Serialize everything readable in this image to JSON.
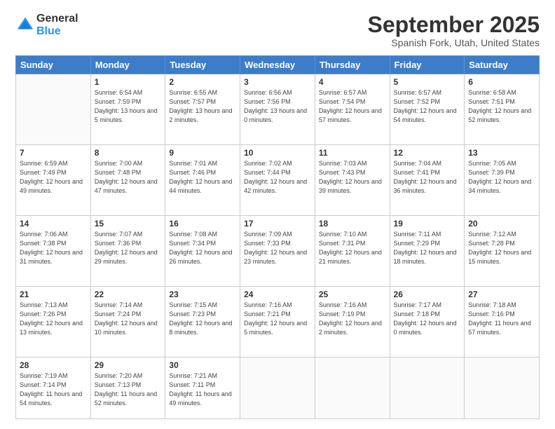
{
  "logo": {
    "general": "General",
    "blue": "Blue"
  },
  "header": {
    "month": "September 2025",
    "location": "Spanish Fork, Utah, United States"
  },
  "days_of_week": [
    "Sunday",
    "Monday",
    "Tuesday",
    "Wednesday",
    "Thursday",
    "Friday",
    "Saturday"
  ],
  "weeks": [
    [
      {
        "day": "",
        "sunrise": "",
        "sunset": "",
        "daylight": ""
      },
      {
        "day": "1",
        "sunrise": "Sunrise: 6:54 AM",
        "sunset": "Sunset: 7:59 PM",
        "daylight": "Daylight: 13 hours and 5 minutes."
      },
      {
        "day": "2",
        "sunrise": "Sunrise: 6:55 AM",
        "sunset": "Sunset: 7:57 PM",
        "daylight": "Daylight: 13 hours and 2 minutes."
      },
      {
        "day": "3",
        "sunrise": "Sunrise: 6:56 AM",
        "sunset": "Sunset: 7:56 PM",
        "daylight": "Daylight: 13 hours and 0 minutes."
      },
      {
        "day": "4",
        "sunrise": "Sunrise: 6:57 AM",
        "sunset": "Sunset: 7:54 PM",
        "daylight": "Daylight: 12 hours and 57 minutes."
      },
      {
        "day": "5",
        "sunrise": "Sunrise: 6:57 AM",
        "sunset": "Sunset: 7:52 PM",
        "daylight": "Daylight: 12 hours and 54 minutes."
      },
      {
        "day": "6",
        "sunrise": "Sunrise: 6:58 AM",
        "sunset": "Sunset: 7:51 PM",
        "daylight": "Daylight: 12 hours and 52 minutes."
      }
    ],
    [
      {
        "day": "7",
        "sunrise": "Sunrise: 6:59 AM",
        "sunset": "Sunset: 7:49 PM",
        "daylight": "Daylight: 12 hours and 49 minutes."
      },
      {
        "day": "8",
        "sunrise": "Sunrise: 7:00 AM",
        "sunset": "Sunset: 7:48 PM",
        "daylight": "Daylight: 12 hours and 47 minutes."
      },
      {
        "day": "9",
        "sunrise": "Sunrise: 7:01 AM",
        "sunset": "Sunset: 7:46 PM",
        "daylight": "Daylight: 12 hours and 44 minutes."
      },
      {
        "day": "10",
        "sunrise": "Sunrise: 7:02 AM",
        "sunset": "Sunset: 7:44 PM",
        "daylight": "Daylight: 12 hours and 42 minutes."
      },
      {
        "day": "11",
        "sunrise": "Sunrise: 7:03 AM",
        "sunset": "Sunset: 7:43 PM",
        "daylight": "Daylight: 12 hours and 39 minutes."
      },
      {
        "day": "12",
        "sunrise": "Sunrise: 7:04 AM",
        "sunset": "Sunset: 7:41 PM",
        "daylight": "Daylight: 12 hours and 36 minutes."
      },
      {
        "day": "13",
        "sunrise": "Sunrise: 7:05 AM",
        "sunset": "Sunset: 7:39 PM",
        "daylight": "Daylight: 12 hours and 34 minutes."
      }
    ],
    [
      {
        "day": "14",
        "sunrise": "Sunrise: 7:06 AM",
        "sunset": "Sunset: 7:38 PM",
        "daylight": "Daylight: 12 hours and 31 minutes."
      },
      {
        "day": "15",
        "sunrise": "Sunrise: 7:07 AM",
        "sunset": "Sunset: 7:36 PM",
        "daylight": "Daylight: 12 hours and 29 minutes."
      },
      {
        "day": "16",
        "sunrise": "Sunrise: 7:08 AM",
        "sunset": "Sunset: 7:34 PM",
        "daylight": "Daylight: 12 hours and 26 minutes."
      },
      {
        "day": "17",
        "sunrise": "Sunrise: 7:09 AM",
        "sunset": "Sunset: 7:33 PM",
        "daylight": "Daylight: 12 hours and 23 minutes."
      },
      {
        "day": "18",
        "sunrise": "Sunrise: 7:10 AM",
        "sunset": "Sunset: 7:31 PM",
        "daylight": "Daylight: 12 hours and 21 minutes."
      },
      {
        "day": "19",
        "sunrise": "Sunrise: 7:11 AM",
        "sunset": "Sunset: 7:29 PM",
        "daylight": "Daylight: 12 hours and 18 minutes."
      },
      {
        "day": "20",
        "sunrise": "Sunrise: 7:12 AM",
        "sunset": "Sunset: 7:28 PM",
        "daylight": "Daylight: 12 hours and 15 minutes."
      }
    ],
    [
      {
        "day": "21",
        "sunrise": "Sunrise: 7:13 AM",
        "sunset": "Sunset: 7:26 PM",
        "daylight": "Daylight: 12 hours and 13 minutes."
      },
      {
        "day": "22",
        "sunrise": "Sunrise: 7:14 AM",
        "sunset": "Sunset: 7:24 PM",
        "daylight": "Daylight: 12 hours and 10 minutes."
      },
      {
        "day": "23",
        "sunrise": "Sunrise: 7:15 AM",
        "sunset": "Sunset: 7:23 PM",
        "daylight": "Daylight: 12 hours and 8 minutes."
      },
      {
        "day": "24",
        "sunrise": "Sunrise: 7:16 AM",
        "sunset": "Sunset: 7:21 PM",
        "daylight": "Daylight: 12 hours and 5 minutes."
      },
      {
        "day": "25",
        "sunrise": "Sunrise: 7:16 AM",
        "sunset": "Sunset: 7:19 PM",
        "daylight": "Daylight: 12 hours and 2 minutes."
      },
      {
        "day": "26",
        "sunrise": "Sunrise: 7:17 AM",
        "sunset": "Sunset: 7:18 PM",
        "daylight": "Daylight: 12 hours and 0 minutes."
      },
      {
        "day": "27",
        "sunrise": "Sunrise: 7:18 AM",
        "sunset": "Sunset: 7:16 PM",
        "daylight": "Daylight: 11 hours and 57 minutes."
      }
    ],
    [
      {
        "day": "28",
        "sunrise": "Sunrise: 7:19 AM",
        "sunset": "Sunset: 7:14 PM",
        "daylight": "Daylight: 11 hours and 54 minutes."
      },
      {
        "day": "29",
        "sunrise": "Sunrise: 7:20 AM",
        "sunset": "Sunset: 7:13 PM",
        "daylight": "Daylight: 11 hours and 52 minutes."
      },
      {
        "day": "30",
        "sunrise": "Sunrise: 7:21 AM",
        "sunset": "Sunset: 7:11 PM",
        "daylight": "Daylight: 11 hours and 49 minutes."
      },
      {
        "day": "",
        "sunrise": "",
        "sunset": "",
        "daylight": ""
      },
      {
        "day": "",
        "sunrise": "",
        "sunset": "",
        "daylight": ""
      },
      {
        "day": "",
        "sunrise": "",
        "sunset": "",
        "daylight": ""
      },
      {
        "day": "",
        "sunrise": "",
        "sunset": "",
        "daylight": ""
      }
    ]
  ]
}
